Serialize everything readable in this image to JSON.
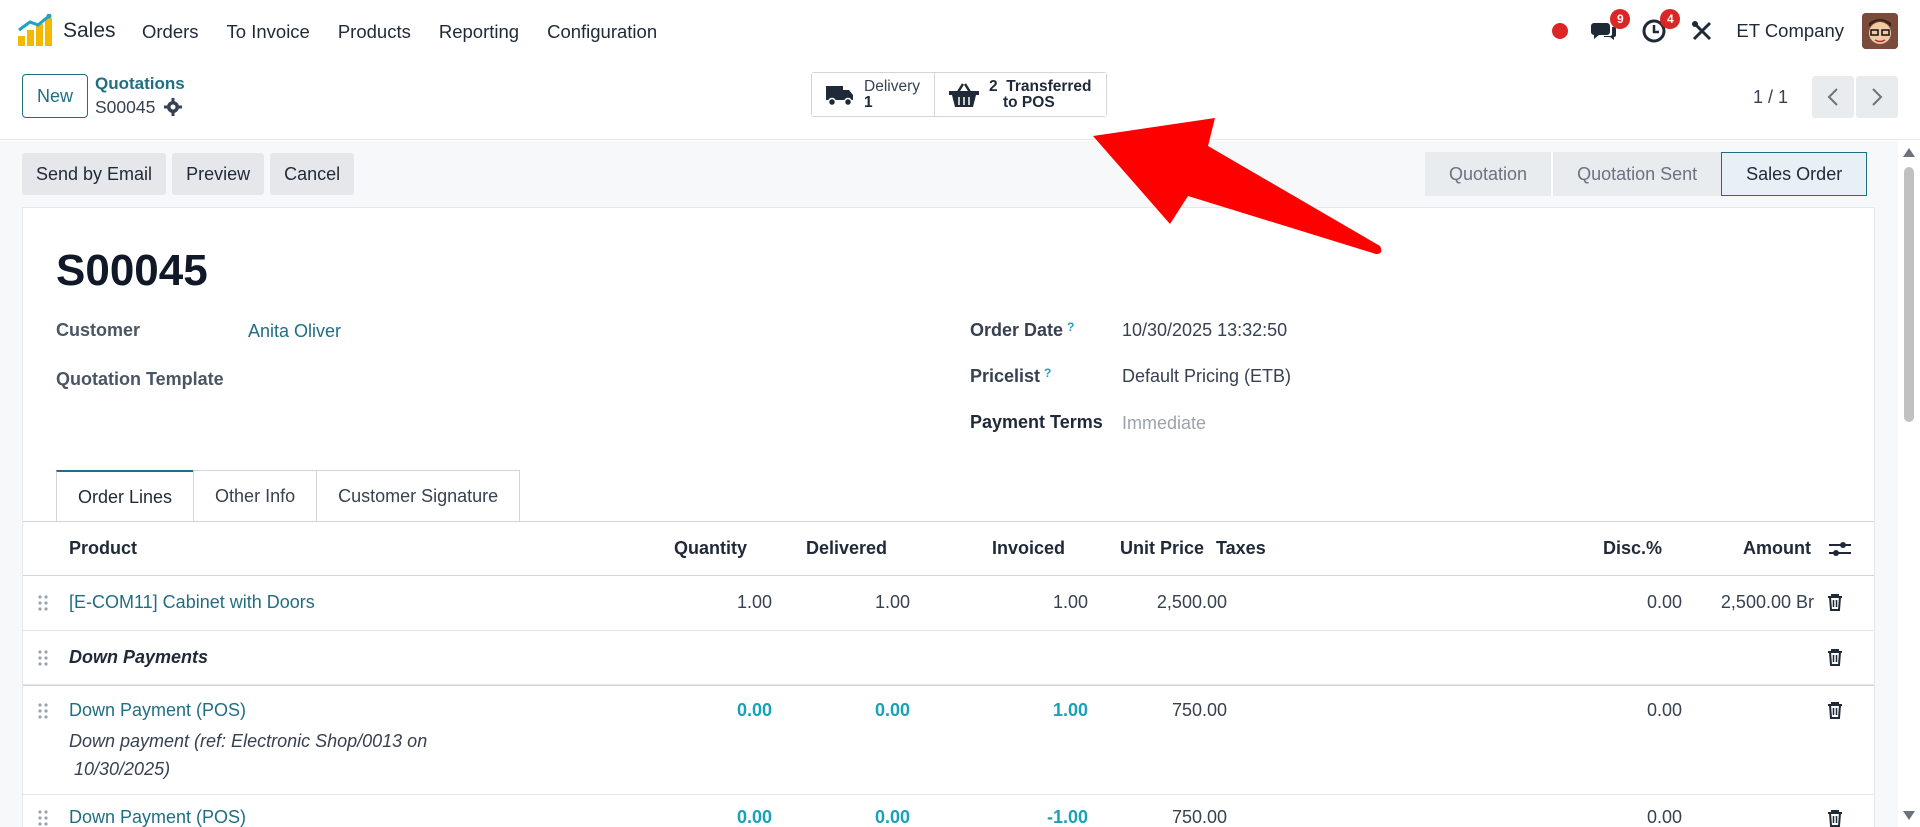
{
  "app": {
    "name": "Sales"
  },
  "menu": [
    "Orders",
    "To Invoice",
    "Products",
    "Reporting",
    "Configuration"
  ],
  "systray": {
    "messages_count": "9",
    "activities_count": "4",
    "company": "ET Company"
  },
  "control": {
    "new_label": "New",
    "breadcrumb_parent": "Quotations",
    "breadcrumb_current": "S00045",
    "smart_buttons": [
      {
        "line1": "Delivery",
        "line2": "1",
        "icon": "truck-icon"
      },
      {
        "line1": "2  Transferred",
        "line2": "to POS",
        "icon": "basket-icon"
      }
    ],
    "pager": "1 / 1"
  },
  "actions": [
    "Send by Email",
    "Preview",
    "Cancel"
  ],
  "stages": [
    "Quotation",
    "Quotation Sent",
    "Sales Order"
  ],
  "active_stage": "Sales Order",
  "form": {
    "name": "S00045",
    "customer_label": "Customer",
    "customer": "Anita Oliver",
    "template_label": "Quotation Template",
    "order_date_label": "Order Date",
    "order_date": "10/30/2025 13:32:50",
    "pricelist_label": "Pricelist",
    "pricelist": "Default Pricing (ETB)",
    "payment_terms_label": "Payment Terms",
    "payment_terms": "Immediate",
    "help_mark": "?"
  },
  "tabs": [
    "Order Lines",
    "Other Info",
    "Customer Signature"
  ],
  "columns": {
    "product": "Product",
    "quantity": "Quantity",
    "delivered": "Delivered",
    "invoiced": "Invoiced",
    "unit_price": "Unit Price",
    "taxes": "Taxes",
    "disc": "Disc.%",
    "amount": "Amount"
  },
  "lines": [
    {
      "product": "[E-COM11] Cabinet with Doors",
      "quantity": "1.00",
      "delivered": "1.00",
      "invoiced": "1.00",
      "unit_price": "2,500.00",
      "disc": "0.00",
      "amount": "2,500.00 Br"
    },
    {
      "section": "Down Payments"
    },
    {
      "product": "Down Payment (POS)",
      "desc1": "Down payment (ref: Electronic Shop/0013 on",
      "desc2": "10/30/2025)",
      "quantity": "0.00",
      "delivered": "0.00",
      "invoiced": "1.00",
      "unit_price": "750.00",
      "disc": "0.00"
    },
    {
      "product": "Down Payment (POS)",
      "quantity": "0.00",
      "delivered": "0.00",
      "invoiced": "-1.00",
      "unit_price": "750.00",
      "disc": "0.00"
    }
  ],
  "colors": {
    "primary": "#1f6e83",
    "accent_cyan": "#17a2b8",
    "badge_red": "#dc2626",
    "arrow_red": "#ff0000"
  }
}
